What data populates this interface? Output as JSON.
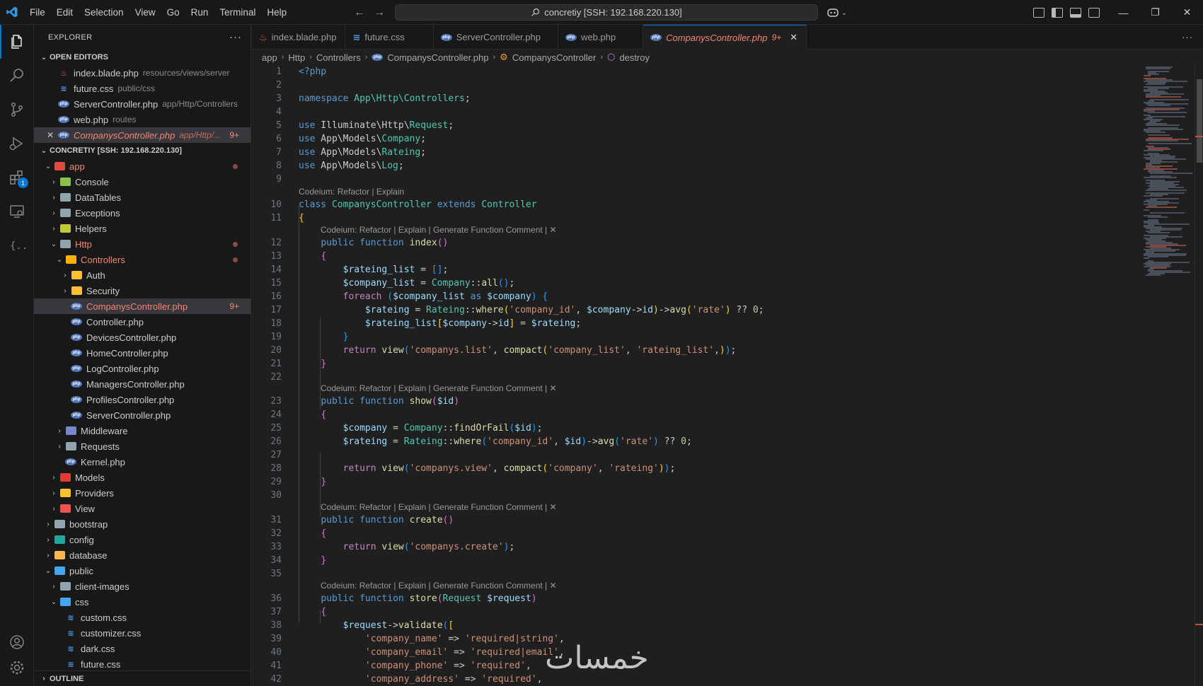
{
  "menu": [
    "File",
    "Edit",
    "Selection",
    "View",
    "Go",
    "Run",
    "Terminal",
    "Help"
  ],
  "command_center": "concretiy [SSH: 192.168.220.130]",
  "activity_badge": "1",
  "explorer": {
    "title": "EXPLORER",
    "open_editors_label": "OPEN EDITORS",
    "open_editors": [
      {
        "name": "index.blade.php",
        "path": "resources/views/server",
        "icon": "blade-icon"
      },
      {
        "name": "future.css",
        "path": "public/css",
        "icon": "css-icon"
      },
      {
        "name": "ServerController.php",
        "path": "app/Http/Controllers",
        "icon": "php-icon"
      },
      {
        "name": "web.php",
        "path": "routes",
        "icon": "php-icon"
      },
      {
        "name": "CompanysController.php",
        "path": "app/Http/...",
        "badge": "9+",
        "icon": "php-icon"
      }
    ],
    "workspace_label": "CONCRETIY [SSH: 192.168.220.130]",
    "tree": {
      "app": "app",
      "console": "Console",
      "datatables": "DataTables",
      "exceptions": "Exceptions",
      "helpers": "Helpers",
      "http": "Http",
      "controllers": "Controllers",
      "auth": "Auth",
      "security": "Security",
      "companys": "CompanysController.php",
      "companys_badge": "9+",
      "controller": "Controller.php",
      "devices": "DevicesController.php",
      "home": "HomeController.php",
      "log": "LogController.php",
      "managers": "ManagersController.php",
      "profiles": "ProfilesController.php",
      "server": "ServerController.php",
      "middleware": "Middleware",
      "requests": "Requests",
      "kernel": "Kernel.php",
      "models": "Models",
      "providers": "Providers",
      "view": "View",
      "bootstrap": "bootstrap",
      "config": "config",
      "database": "database",
      "public": "public",
      "client_images": "client-images",
      "css": "css",
      "custom_css": "custom.css",
      "customizer_css": "customizer.css",
      "dark_css": "dark.css",
      "future_css": "future.css"
    },
    "outline_label": "OUTLINE"
  },
  "tabs": [
    {
      "label": "index.blade.php",
      "icon": "blade-icon"
    },
    {
      "label": "future.css",
      "icon": "css-icon"
    },
    {
      "label": "ServerController.php",
      "icon": "php-icon"
    },
    {
      "label": "web.php",
      "icon": "php-icon"
    },
    {
      "label": "CompanysController.php",
      "badge": "9+",
      "icon": "php-icon",
      "active": true
    }
  ],
  "breadcrumb": [
    "app",
    "Http",
    "Controllers",
    "CompanysController.php",
    "CompanysController",
    "destroy"
  ],
  "codelens": {
    "class": "Codeium: Refactor | Explain",
    "method": "Codeium: Refactor | Explain | Generate Function Comment | ✕"
  },
  "line_numbers": [
    "1",
    "2",
    "3",
    "4",
    "5",
    "6",
    "7",
    "8",
    "9",
    "10",
    "11",
    "12",
    "13",
    "14",
    "15",
    "16",
    "17",
    "18",
    "19",
    "20",
    "21",
    "22",
    "23",
    "24",
    "25",
    "26",
    "27",
    "28",
    "29",
    "30",
    "31",
    "32",
    "33",
    "34",
    "35",
    "36",
    "37",
    "38",
    "39",
    "40",
    "41",
    "42"
  ],
  "watermark": "خمسات",
  "colors": {
    "accent": "#0078d4",
    "modified": "#f48771",
    "editor_bg": "#1f1f1f",
    "sidebar_bg": "#181818"
  }
}
